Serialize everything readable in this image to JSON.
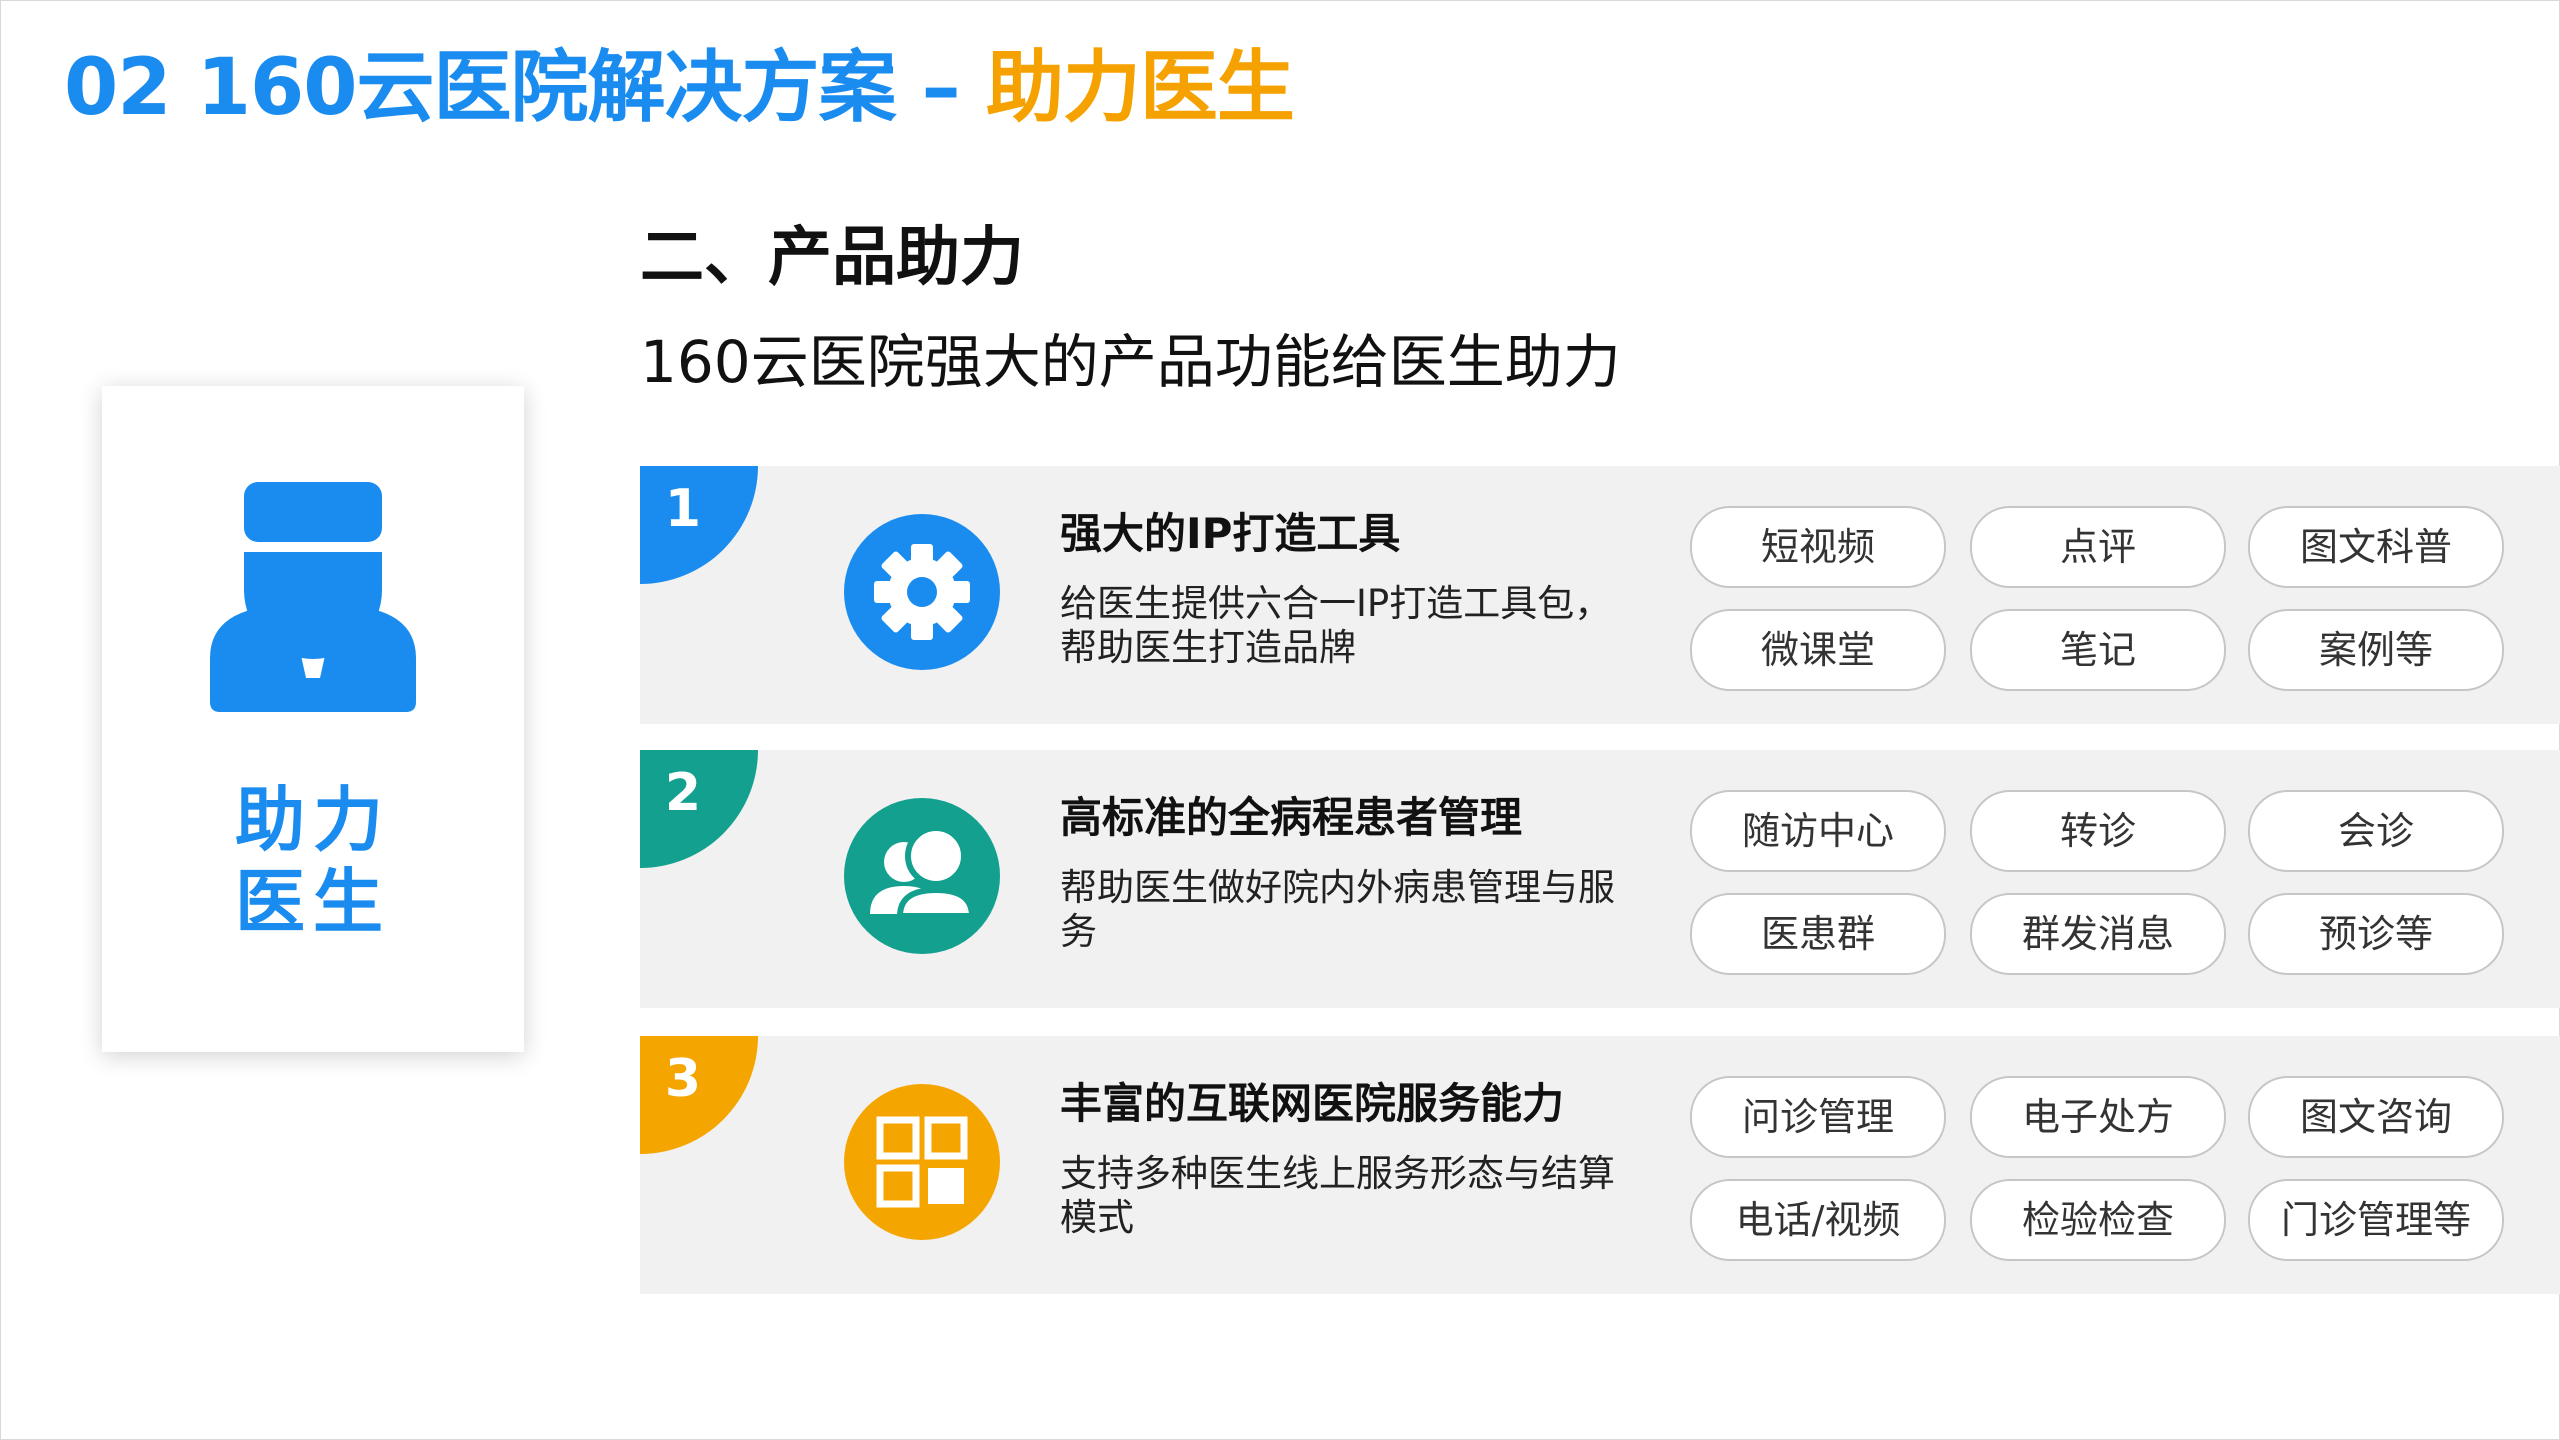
{
  "title": {
    "prefix": "02 160云医院解决方案 – ",
    "highlight": "助力医生"
  },
  "section": {
    "heading": "二、产品助力",
    "subtitle": "160云医院强大的产品功能给医生助力"
  },
  "side_card": {
    "line1": "助力",
    "line2": "医生",
    "icon": "doctor-icon"
  },
  "colors": {
    "blue": "#1a8cf0",
    "green": "#13a08f",
    "orange": "#f5a500",
    "title_highlight": "#f5a100"
  },
  "features": [
    {
      "number": "1",
      "title": "强大的IP打造工具",
      "desc": "给医生提供六合一IP打造工具包，帮助医生打造品牌",
      "icon": "gear-icon",
      "tags": [
        "短视频",
        "点评",
        "图文科普",
        "微课堂",
        "笔记",
        "案例等"
      ]
    },
    {
      "number": "2",
      "title": "高标准的全病程患者管理",
      "desc": "帮助医生做好院内外病患管理与服务",
      "icon": "users-icon",
      "tags": [
        "随访中心",
        "转诊",
        "会诊",
        "医患群",
        "群发消息",
        "预诊等"
      ]
    },
    {
      "number": "3",
      "title": "丰富的互联网医院服务能力",
      "desc": "支持多种医生线上服务形态与结算模式",
      "icon": "grid-icon",
      "tags": [
        "问诊管理",
        "电子处方",
        "图文咨询",
        "电话/视频",
        "检验检查",
        "门诊管理等"
      ]
    }
  ]
}
